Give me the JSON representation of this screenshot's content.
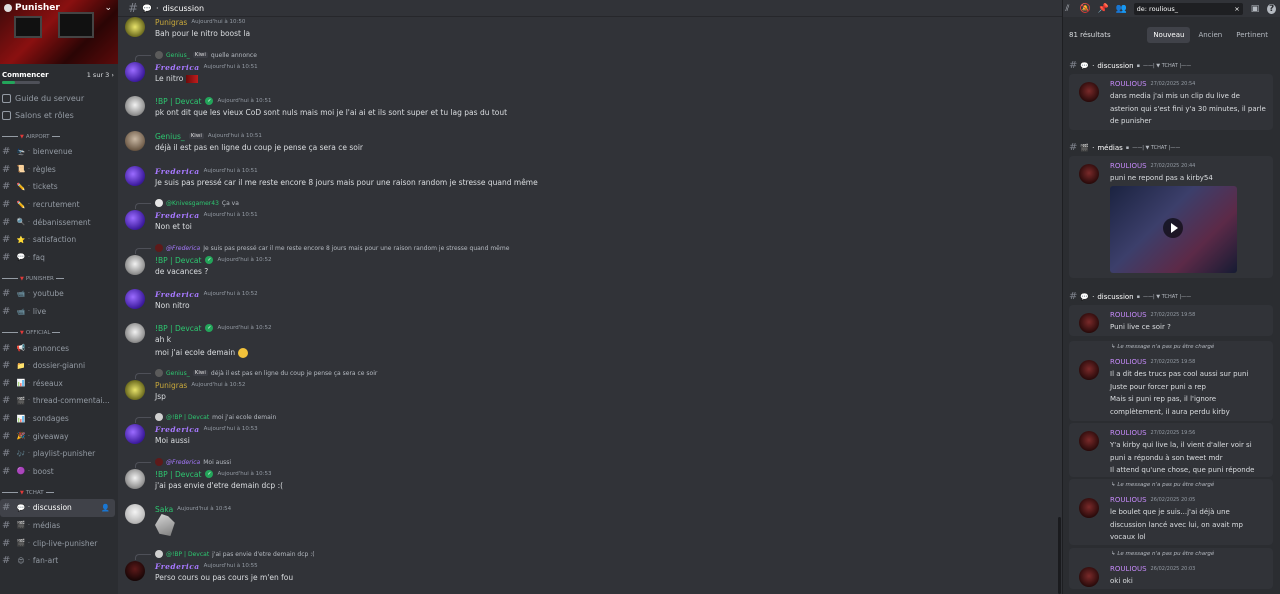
{
  "server": {
    "name": "Punisher",
    "onboarding_label": "Commencer",
    "onboarding_count": "1 sur 3",
    "onboarding_progress": 0.33
  },
  "sidebar_links": [
    "Guide du serveur",
    "Salons et rôles"
  ],
  "categories": [
    {
      "name": "AIRPORT",
      "channels": [
        {
          "emoji": "🛬",
          "name": "bienvenue"
        },
        {
          "emoji": "📜",
          "name": "règles"
        },
        {
          "emoji": "✏️",
          "name": "tickets"
        },
        {
          "emoji": "✏️",
          "name": "recrutement"
        },
        {
          "emoji": "🔍",
          "name": "débanissement"
        },
        {
          "emoji": "⭐",
          "name": "satisfaction"
        },
        {
          "emoji": "💬",
          "name": "faq"
        }
      ]
    },
    {
      "name": "PUNISHER",
      "channels": [
        {
          "emoji": "📹",
          "name": "youtube"
        },
        {
          "emoji": "📹",
          "name": "live"
        }
      ]
    },
    {
      "name": "OFFICIAL",
      "channels": [
        {
          "emoji": "📢",
          "name": "annonces"
        },
        {
          "emoji": "📁",
          "name": "dossier-gianni"
        },
        {
          "emoji": "📊",
          "name": "réseaux"
        },
        {
          "emoji": "🎬",
          "name": "thread-commentai..."
        },
        {
          "emoji": "📊",
          "name": "sondages"
        },
        {
          "emoji": "🎉",
          "name": "giveaway"
        },
        {
          "emoji": "🎶",
          "name": "playlist-punisher"
        },
        {
          "emoji": "🟣",
          "name": "boost"
        }
      ]
    },
    {
      "name": "TCHAT",
      "channels": [
        {
          "emoji": "💬",
          "name": "discussion",
          "active": true
        },
        {
          "emoji": "🎬",
          "name": "médias"
        },
        {
          "emoji": "🎬",
          "name": "clip-live-punisher"
        },
        {
          "emoji": "😍",
          "name": "fan-art"
        }
      ]
    }
  ],
  "channel_header": {
    "name": "discussion"
  },
  "messages": [
    {
      "author": "Punigras",
      "time": "Aujourd'hui à 10:50",
      "text": "Bah pour le nitro boost la"
    },
    {
      "reply_to": "Genius_",
      "reply_tag": "Kiwi",
      "reply_text": "quelle annonce",
      "author": "Frederica",
      "time": "Aujourd'hui à 10:51",
      "text": "Le nitro"
    },
    {
      "author": "!BP | Devcat",
      "time": "Aujourd'hui à 10:51",
      "text": "pk ont dit que les vieux CoD sont nuls mais moi je l'ai ai et ils sont super et tu lag pas du tout"
    },
    {
      "author": "Genius_",
      "tag": "Kiwi",
      "time": "Aujourd'hui à 10:51",
      "text": "déjà il est pas en ligne du coup je pense ça sera ce soir"
    },
    {
      "author": "Frederica",
      "time": "Aujourd'hui à 10:51",
      "text": "Je suis pas pressé car il me reste encore 8 jours mais pour une raison random je stresse quand même"
    },
    {
      "reply_to": "@Knivesgamer43",
      "reply_text": "Ça va",
      "author": "Frederica",
      "time": "Aujourd'hui à 10:51",
      "text": "Non et toi"
    },
    {
      "reply_to": "@Frederica",
      "reply_text": "Je suis pas pressé car il me reste encore 8 jours mais pour une raison random je stresse quand même",
      "author": "!BP | Devcat",
      "time": "Aujourd'hui à 10:52",
      "text": "de vacances ?"
    },
    {
      "author": "Frederica",
      "time": "Aujourd'hui à 10:52",
      "text": "Non nitro"
    },
    {
      "author": "!BP | Devcat",
      "time": "Aujourd'hui à 10:52",
      "text": "ah k",
      "text2": "moi j'ai ecole demain"
    },
    {
      "reply_to": "Genius_",
      "reply_tag": "Kiwi",
      "reply_text": "déjà il est pas en ligne du coup je pense ça sera ce soir",
      "author": "Punigras",
      "time": "Aujourd'hui à 10:52",
      "text": "Jsp"
    },
    {
      "reply_to": "@!BP | Devcat",
      "reply_text": "moi j'ai ecole demain",
      "author": "Frederica",
      "time": "Aujourd'hui à 10:53",
      "text": "Moi aussi"
    },
    {
      "reply_to": "@Frederica",
      "reply_text": "Moi aussi",
      "author": "!BP | Devcat",
      "time": "Aujourd'hui à 10:53",
      "text": "j'ai pas envie d'etre demain dcp :("
    },
    {
      "author": "Saka",
      "time": "Aujourd'hui à 10:54",
      "text": ""
    },
    {
      "reply_to": "@!BP | Devcat",
      "reply_text": "j'ai pas envie d'etre demain dcp :(",
      "author": "Frederica",
      "time": "Aujourd'hui à 10:55",
      "text": "Perso cours ou pas cours je m'en fou"
    }
  ],
  "search": {
    "query": "de: roulious_",
    "result_count": "81 résultats",
    "sort_options": [
      "Nouveau",
      "Ancien",
      "Pertinent"
    ],
    "active_sort": "Nouveau",
    "not_loaded": "Le message n'a pas pu être chargé",
    "sections": [
      {
        "channel": "discussion",
        "category": "TCHAT",
        "results": [
          {
            "author": "ROULIOUS",
            "time": "27/02/2025 20:54",
            "text": "dans media j'ai mis un clip du live de\nasterion qui s'est fini y'a 30 minutes, il parle\nde punisher"
          }
        ]
      },
      {
        "channel": "médias",
        "category": "TCHAT",
        "results": [
          {
            "author": "ROULIOUS",
            "time": "27/02/2025 20:44",
            "text": "puni ne repond pas a kirby54"
          }
        ]
      },
      {
        "channel": "discussion",
        "category": "TCHAT",
        "results": [
          {
            "author": "ROULIOUS",
            "time": "27/02/2025 19:58",
            "text": "Puni live ce soir ?"
          },
          {
            "author": "ROULIOUS",
            "time": "27/02/2025 19:58",
            "text": "Il a dit des trucs pas cool aussi sur puni\nJuste pour forcer puni a rep\nMais si puni rep pas, il l'ignore\ncomplètement, il aura perdu kirby"
          },
          {
            "author": "ROULIOUS",
            "time": "27/02/2025 19:56",
            "text": "Y'a kirby qui live la, il vient d'aller voir si\npuni a répondu à son tweet mdr\nIl attend qu'une chose, que puni réponde"
          },
          {
            "author": "ROULIOUS",
            "time": "26/02/2025 20:05",
            "text": "le boulet que je suis...j'ai déjà une\ndiscussion lancé avec lui, on avait mp\nvocaux lol"
          },
          {
            "author": "ROULIOUS",
            "time": "26/02/2025 20:03",
            "text": "oki oki"
          }
        ]
      }
    ]
  }
}
